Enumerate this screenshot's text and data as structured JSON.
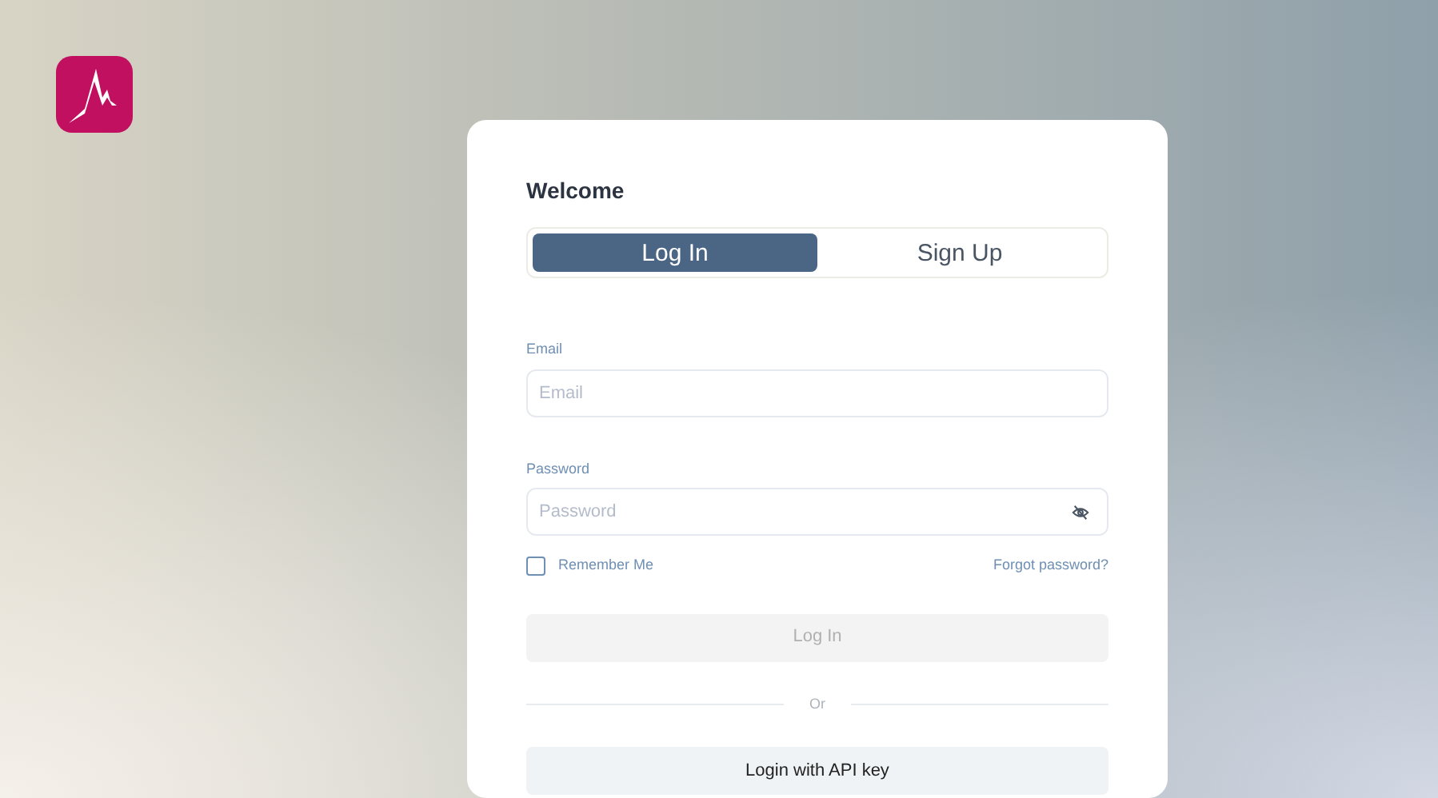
{
  "heading": "Welcome",
  "tabs": [
    {
      "label": "Log In",
      "selected": true
    },
    {
      "label": "Sign Up",
      "selected": false
    }
  ],
  "fields": [
    {
      "label": "Email",
      "placeholder": "Email",
      "kind": "text"
    },
    {
      "label": "Password",
      "placeholder": "Password",
      "kind": "password"
    }
  ],
  "remember": {
    "label": "Remember Me",
    "checked": false
  },
  "forgot_link": "Forgot password?",
  "login_button": {
    "label": "Log In",
    "disabled": true
  },
  "divider": "Or",
  "api_button": "Login with API key"
}
